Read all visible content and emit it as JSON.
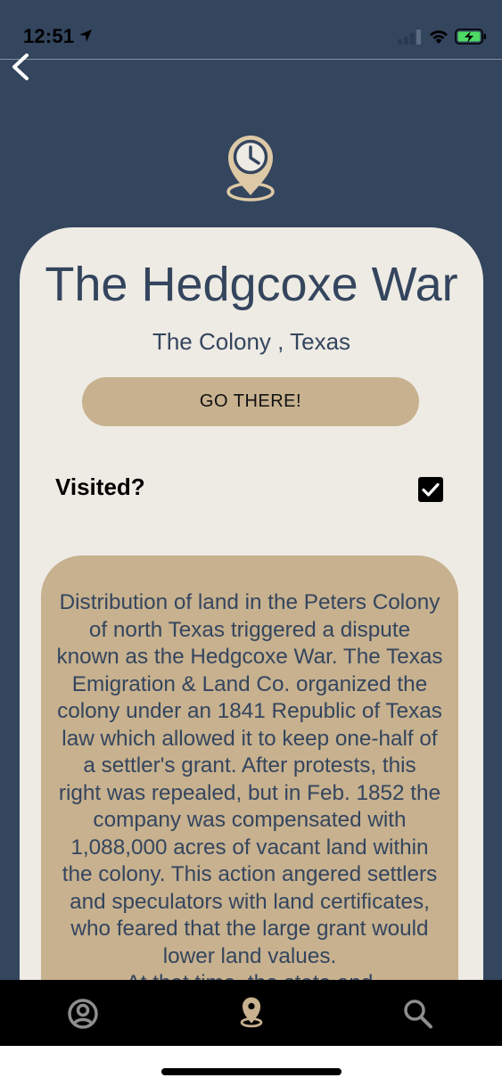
{
  "status_bar": {
    "time": "12:51"
  },
  "place": {
    "title": "The Hedgcoxe War",
    "location": "The Colony , Texas"
  },
  "actions": {
    "go_label": "GO THERE!"
  },
  "visited": {
    "label": "Visited?",
    "checked": true
  },
  "description": "Distribution of land in the Peters Colony\nof north Texas triggered a dispute\nknown as the Hedgcoxe War.  The Texas\nEmigration & Land Co. organized the\ncolony under an 1841 Republic of Texas\nlaw which allowed it to keep one-half of\na settler's grant.  After protests, this\nright was repealed, but in Feb. 1852 the\ncompany was compensated with\n1,088,000 acres of vacant land within\nthe colony.  This action angered settlers\nand speculators with land certificates,\nwho feared that the large grant would\nlower land values.\nAt that time, the state and",
  "tabs": [
    {
      "name": "profile-icon"
    },
    {
      "name": "map-pin-icon",
      "active": true
    },
    {
      "name": "search-icon"
    }
  ],
  "colors": {
    "background": "#34455e",
    "card": "#eeebe4",
    "accent": "#c7b18f",
    "text_primary": "#34455e",
    "active_tab": "#c7b18f",
    "inactive_tab": "#8e8e8e"
  }
}
